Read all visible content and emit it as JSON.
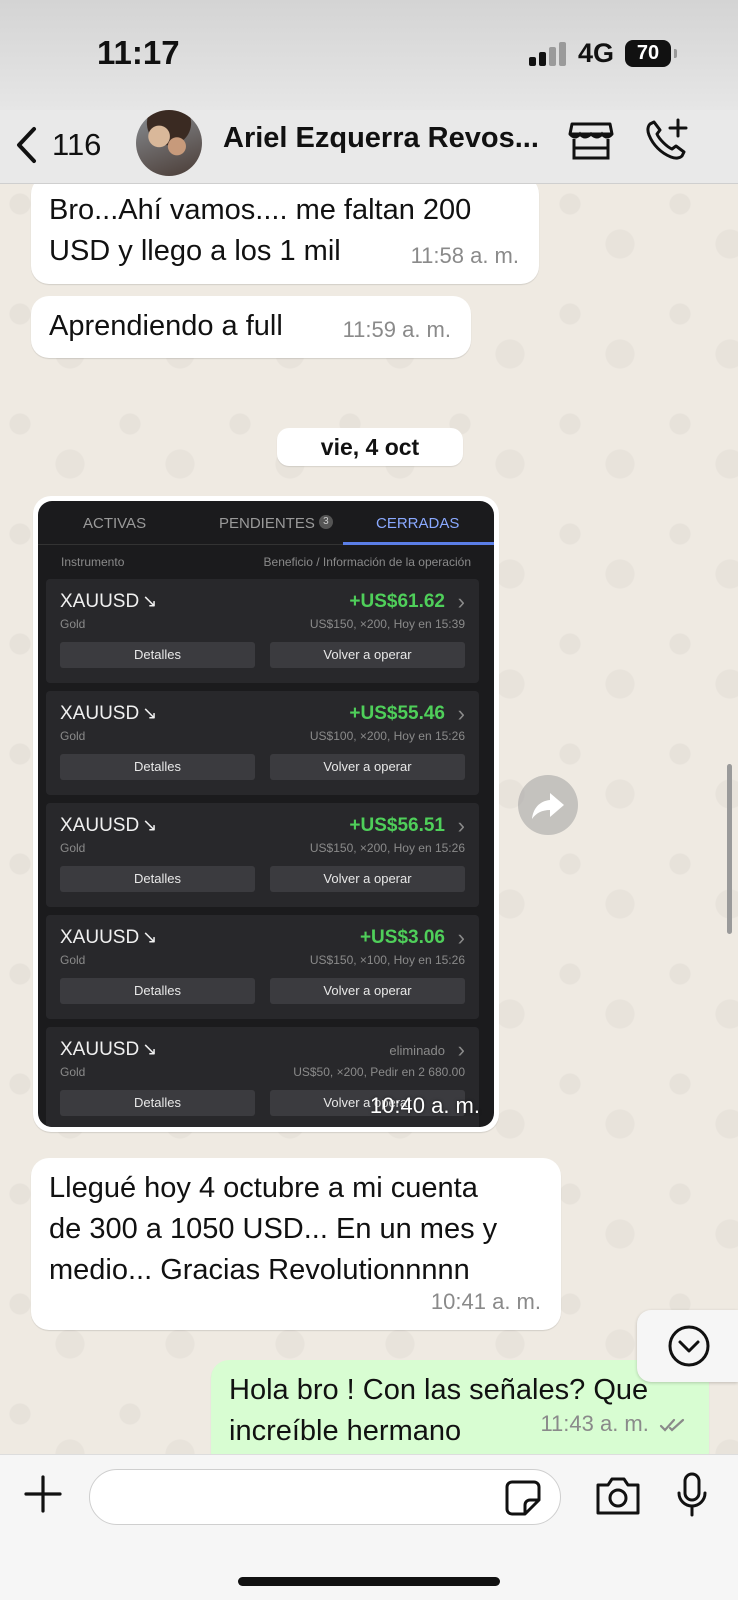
{
  "status_bar": {
    "time": "11:17",
    "network": "4G",
    "battery": "70"
  },
  "header": {
    "back_count": "116",
    "contact_name": "Ariel Ezquerra Revos..."
  },
  "messages": [
    {
      "text_lines": [
        "Bro...Ahí vamos.... me faltan 200",
        "USD y llego a los 1 mil"
      ],
      "time": "11:58 a. m."
    },
    {
      "text_lines": [
        "Aprendiendo a full"
      ],
      "time": "11:59 a. m."
    }
  ],
  "date_divider": "vie, 4 oct",
  "trade_screenshot": {
    "tabs": [
      "ACTIVAS",
      "PENDIENTES",
      "CERRADAS"
    ],
    "pending_badge": "3",
    "col_instrument": "Instrumento",
    "col_benefit": "Beneficio / Información de la operación",
    "detail_label": "Detalles",
    "reopen_label": "Volver a operar",
    "trades": [
      {
        "symbol": "XAUUSD",
        "name": "Gold",
        "profit": "+US$61.62",
        "info": "US$150, ×200, Hoy en 15:39"
      },
      {
        "symbol": "XAUUSD",
        "name": "Gold",
        "profit": "+US$55.46",
        "info": "US$100, ×200, Hoy en 15:26"
      },
      {
        "symbol": "XAUUSD",
        "name": "Gold",
        "profit": "+US$56.51",
        "info": "US$150, ×200, Hoy en 15:26"
      },
      {
        "symbol": "XAUUSD",
        "name": "Gold",
        "profit": "+US$3.06",
        "info": "US$150, ×100, Hoy en 15:26"
      },
      {
        "symbol": "XAUUSD",
        "name": "Gold",
        "profit": "eliminado",
        "info": "US$50, ×200, Pedir en 2 680.00"
      }
    ],
    "time": "10:40 a. m."
  },
  "message_after": {
    "text_lines": [
      "Llegué hoy 4 octubre a mi cuenta",
      "de 300 a 1050 USD... En un mes y",
      "medio... Gracias Revolutionnnnn"
    ],
    "time": "10:41 a. m."
  },
  "outgoing": {
    "text_lines": [
      "Hola bro ! Con las señales? Que",
      "increíble hermano"
    ],
    "time": "11:43 a. m."
  },
  "input": {
    "placeholder": ""
  },
  "colors": {
    "chat_bg": "#efeae2",
    "outgoing_bubble": "#d8fdd2",
    "profit_green": "#4fcf5a",
    "tab_active": "#8aa9ff"
  }
}
